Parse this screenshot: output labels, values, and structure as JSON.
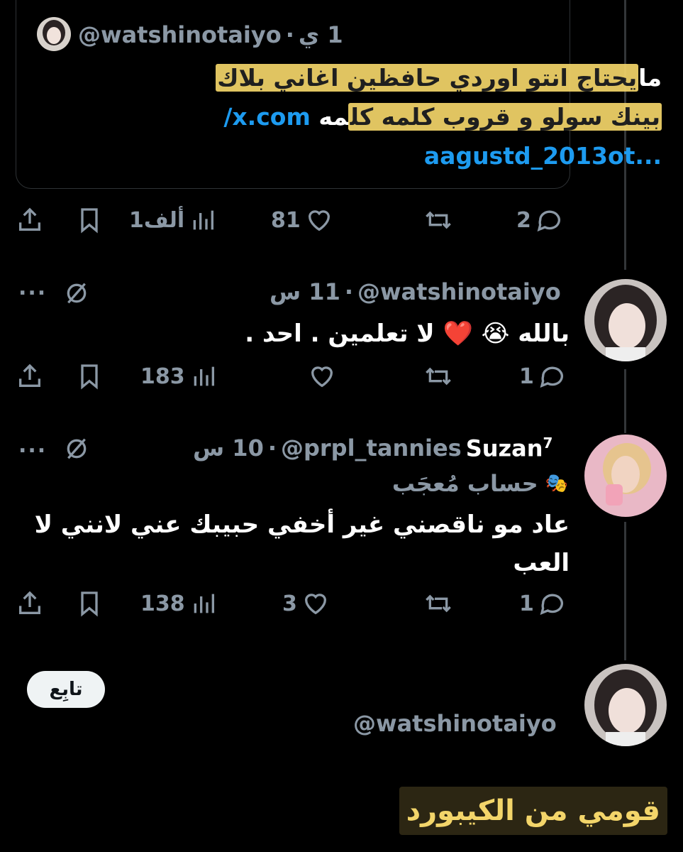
{
  "quote": {
    "handle": "@watshinotaiyo",
    "time": "1 ي",
    "text_highlight_1": "يحتاج انتو اوردي حافظين اغاني بلاك",
    "text_prefix_1": "ما",
    "text_highlight_2": "بينك سولو و قروب كلمه كل",
    "text_suffix_2": "مه",
    "link_1": "x.com/",
    "link_2": "...aagustd_2013ot"
  },
  "quote_actions": {
    "replies": "2",
    "likes": "81",
    "views": "1ألف"
  },
  "tweet1": {
    "handle": "@watshinotaiyo",
    "time": "11 س",
    "text": "بالله 😭 ❤️ لا تعلمين . احد .",
    "replies": "1",
    "views": "183",
    "more": "..."
  },
  "tweet2": {
    "name": "Suzan",
    "name_sup": "7",
    "handle": "@prpl_tannies",
    "time": "10 س",
    "label": "حساب مُعجَب",
    "text_line1": "عاد مو ناقصني غير أخفي حبيبك عني لانني لا",
    "text_line2": "العب",
    "replies": "1",
    "likes": "3",
    "views": "138",
    "more": "..."
  },
  "follow": {
    "button_label": "تابِع",
    "handle": "@watshinotaiyo"
  },
  "caption": "قومي من الكيبورد",
  "colors": {
    "background": "#000000",
    "text": "#e7e9ea",
    "muted": "#8b98a5",
    "link": "#1d9bf0",
    "highlight": "#f3d56a"
  }
}
